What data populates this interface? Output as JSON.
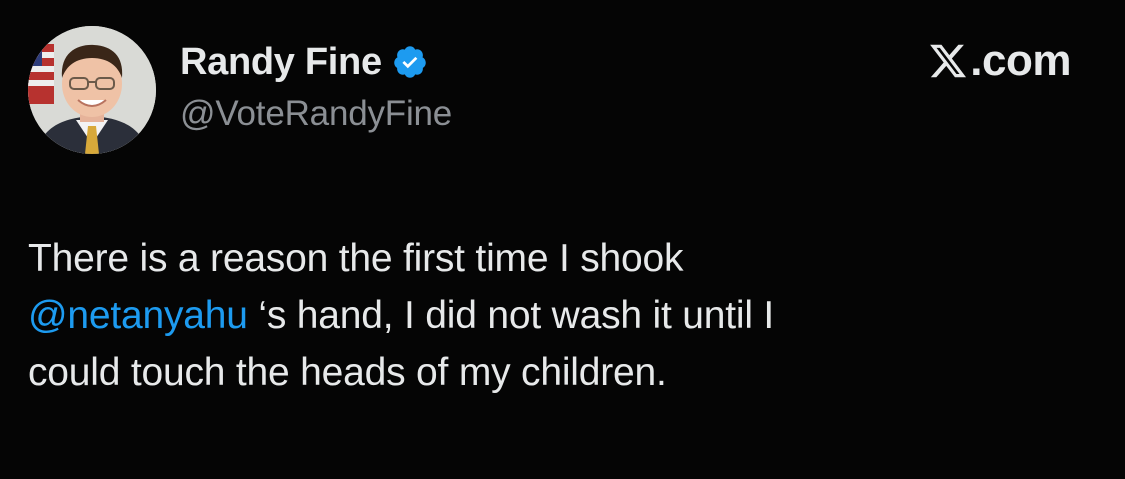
{
  "author": {
    "display_name": "Randy Fine",
    "handle": "@VoteRandyFine",
    "verified": true
  },
  "brand": {
    "label": ".com",
    "icon": "x-logo-icon"
  },
  "tweet": {
    "line1": "There is a reason the first time I shook",
    "mention": "@netanyahu",
    "line2_rest": " ‘s hand, I did not wash it until I",
    "line3": "could touch the heads of my children."
  },
  "colors": {
    "background": "#050505",
    "text": "#e7e9ea",
    "secondary_text": "#8b8f94",
    "mention": "#1d9bf0",
    "verified_badge": "#1d9bf0"
  }
}
